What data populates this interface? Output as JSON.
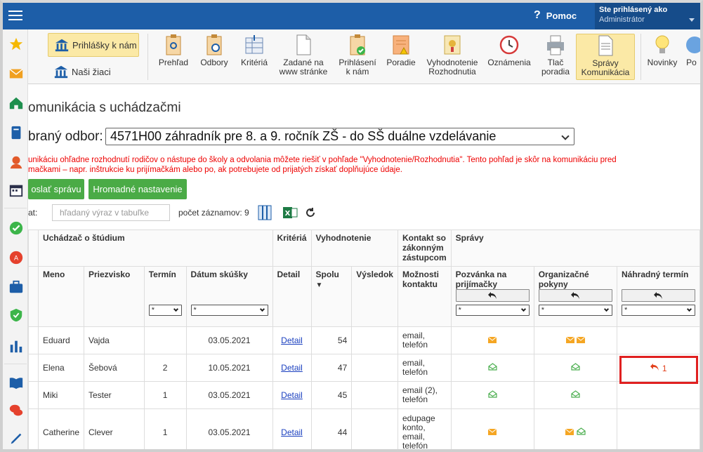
{
  "topbar": {
    "help_icon": "?",
    "help_label": "Pomoc",
    "user_line1": "Ste prihlásený ako",
    "user_line2": "Administrátor"
  },
  "rail_icons": [
    "star-icon",
    "mail-icon",
    "home-icon",
    "book-icon",
    "person-icon",
    "calendar-icon",
    "check-icon",
    "badge-icon",
    "briefcase-icon",
    "shield-icon",
    "chart-icon",
    "open-book-icon",
    "chat-icon",
    "pen-icon"
  ],
  "toolbar": {
    "prihlasky": "Prihlášky k nám",
    "ziaci": "Naši žiaci",
    "tools": [
      {
        "l1": "Prehľad",
        "l2": ""
      },
      {
        "l1": "Odbory",
        "l2": ""
      },
      {
        "l1": "Kritériá",
        "l2": ""
      },
      {
        "l1": "Zadané na",
        "l2": "www stránke"
      },
      {
        "l1": "Prihlásení",
        "l2": "k nám"
      },
      {
        "l1": "Poradie",
        "l2": ""
      },
      {
        "l1": "Vyhodnotenie",
        "l2": "Rozhodnutia"
      },
      {
        "l1": "Oznámenia",
        "l2": ""
      },
      {
        "l1": "Tlač",
        "l2": "poradia"
      },
      {
        "l1": "Správy",
        "l2": "Komunikácia"
      },
      {
        "l1": "Novinky",
        "l2": ""
      },
      {
        "l1": "Po",
        "l2": ""
      }
    ]
  },
  "page": {
    "title": "omunikácia s uchádzačmi",
    "odbor_label": "braný odbor:",
    "odbor_value": "4571H00 záhradník pre 8. a 9. ročník ZŠ - do SŠ duálne vzdelávanie",
    "note_l1": "unikáciu ohľadne rozhodnutí rodičov o nástupe do školy a odvolania môžete riešiť v pohľade \"Vyhodnotenie/Rozhodnutia\". Tento pohľad je skôr na komunikáciu pred",
    "note_l2": "mačkami – napr. inštrukcie ku prijímačkám alebo po, ak potrebujete od prijatých získať doplňujúce údaje.",
    "btn_send": "oslať správu",
    "btn_bulk": "Hromadné nastavenie",
    "filter_label": "at:",
    "search_placeholder": "hľadaný výraz v tabuľke",
    "count_text": "počet záznamov: 9"
  },
  "table": {
    "h_group1": "Uchádzač o štúdium",
    "h_group2": "Kritériá",
    "h_group3": "Vyhodnotenie",
    "h_group4": "Kontakt so zákonným zástupcom",
    "h_group5": "Správy",
    "h_meno": "Meno",
    "h_priezvisko": "Priezvisko",
    "h_termin": "Termín",
    "h_datum": "Dátum skúšky",
    "h_detail": "Detail",
    "h_spolu": "Spolu",
    "h_vysledok": "Výsledok",
    "h_moznosti": "Možnosti kontaktu",
    "h_pozvanka": "Pozvánka na prijímačky",
    "h_org": "Organizačné pokyny",
    "h_nahradny": "Náhradný termín",
    "select_all": "*",
    "rows": [
      {
        "meno": "Eduard",
        "priezvisko": "Vajda",
        "termin": "",
        "datum": "03.05.2021",
        "detail": "Detail",
        "spolu": "54",
        "vysledok": "",
        "kontakt": "email,\ntelefón",
        "pozvanka": "envelope",
        "org": "envelope-envelope",
        "nahradny": ""
      },
      {
        "meno": "Elena",
        "priezvisko": "Šebová",
        "termin": "2",
        "datum": "10.05.2021",
        "detail": "Detail",
        "spolu": "47",
        "vysledok": "",
        "kontakt": "email,\ntelefón",
        "pozvanka": "open",
        "org": "open",
        "nahradny": "1"
      },
      {
        "meno": "Miki",
        "priezvisko": "Tester",
        "termin": "1",
        "datum": "03.05.2021",
        "detail": "Detail",
        "spolu": "45",
        "vysledok": "",
        "kontakt": "email (2),\ntelefón",
        "pozvanka": "open",
        "org": "open",
        "nahradny": ""
      },
      {
        "meno": "Catherine",
        "priezvisko": "Clever",
        "termin": "1",
        "datum": "03.05.2021",
        "detail": "Detail",
        "spolu": "44",
        "vysledok": "",
        "kontakt": "edupage\nkonto,\nemail,\ntelefón",
        "pozvanka": "envelope",
        "org": "envelope-open",
        "nahradny": ""
      }
    ]
  },
  "colors": {
    "topbar": "#1d5ea8",
    "green_btn": "#4aab46",
    "envelope": "#f5a623",
    "open_envelope": "#4caf50",
    "reply_red": "#e2401c",
    "highlight": "#e02020"
  }
}
